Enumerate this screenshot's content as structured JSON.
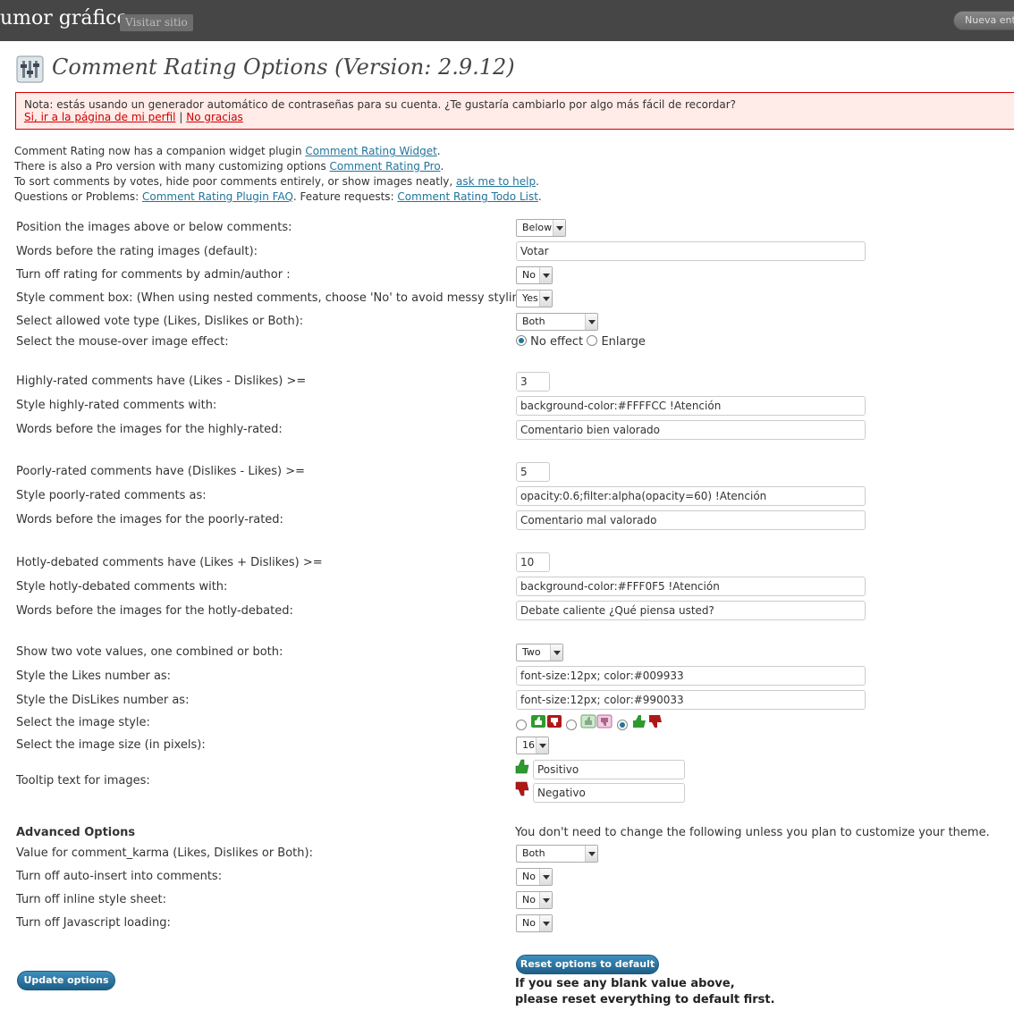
{
  "header": {
    "site_title": "umor gráfico",
    "visit_site": "Visitar sitio",
    "new_button": "Nueva ent"
  },
  "page": {
    "title": "Comment Rating Options (Version: 2.9.12)"
  },
  "notice": {
    "text": "Nota: estás usando un generador automático de contraseñas para su cuenta. ¿Te gustaría cambiarlo por algo más fácil de recordar?",
    "link_profile": "Si, ir a la página de mi perfil",
    "separator": "|",
    "link_no": "No gracias"
  },
  "intro": {
    "line1_pre": "Comment Rating now has a companion widget plugin ",
    "line1_link": "Comment Rating Widget",
    "line1_post": ".",
    "line2_pre": "There is also a Pro version with many customizing options ",
    "line2_link": "Comment Rating Pro",
    "line2_post": ".",
    "line3_pre": "To sort comments by votes, hide poor comments entirely, or show images neatly, ",
    "line3_link": "ask me to help",
    "line3_post": ".",
    "line4_pre": "Questions or Problems: ",
    "line4_link1": "Comment Rating Plugin FAQ",
    "line4_mid": ". Feature requests: ",
    "line4_link2": "Comment Rating Todo List",
    "line4_post": "."
  },
  "options": {
    "position_label": "Position the images above or below comments:",
    "position_value": "Below",
    "words_before_label": "Words before the rating images (default):",
    "words_before_value": "Votar",
    "admin_label": "Turn off rating for comments by admin/author :",
    "admin_value": "No",
    "style_box_label": "Style comment box: (When using nested comments, choose 'No' to avoid messy styling.)",
    "style_box_value": "Yes",
    "vote_type_label": "Select allowed vote type (Likes, Dislikes or Both):",
    "vote_type_value": "Both",
    "mouseover_label": "Select the mouse-over image effect:",
    "mouseover_opt1": "No effect",
    "mouseover_opt2": "Enlarge",
    "high_label": "Highly-rated comments have (Likes - Dislikes) >=",
    "high_value": "3",
    "high_style_label": "Style highly-rated comments with:",
    "high_style_value": "background-color:#FFFFCC !Atención",
    "high_words_label": "Words before the images for the highly-rated:",
    "high_words_value": "Comentario bien valorado",
    "poor_label": "Poorly-rated comments have (Dislikes - Likes) >=",
    "poor_value": "5",
    "poor_style_label": "Style poorly-rated comments as:",
    "poor_style_value": "opacity:0.6;filter:alpha(opacity=60) !Atención",
    "poor_words_label": "Words before the images for the poorly-rated:",
    "poor_words_value": "Comentario mal valorado",
    "hot_label": "Hotly-debated comments have (Likes + Dislikes) >=",
    "hot_value": "10",
    "hot_style_label": "Style hotly-debated comments with:",
    "hot_style_value": "background-color:#FFF0F5 !Atención",
    "hot_words_label": "Words before the images for the hotly-debated:",
    "hot_words_value": "Debate caliente ¿Qué piensa usted?",
    "two_values_label": "Show two vote values, one combined or both:",
    "two_values_value": "Two",
    "likes_style_label": "Style the Likes number as:",
    "likes_style_value": "font-size:12px; color:#009933",
    "dislikes_style_label": "Style the DisLikes number as:",
    "dislikes_style_value": "font-size:12px; color:#990033",
    "image_style_label": "Select the image style:",
    "image_size_label": "Select the image size (in pixels):",
    "image_size_value": "16",
    "tooltip_label": "Tooltip text for images:",
    "tooltip_positive": "Positivo",
    "tooltip_negative": "Negativo"
  },
  "advanced": {
    "heading": "Advanced Options",
    "note": "You don't need to change the following unless you plan to customize your theme.",
    "karma_label": "Value for comment_karma (Likes, Dislikes or Both):",
    "karma_value": "Both",
    "autoinsert_label": "Turn off auto-insert into comments:",
    "autoinsert_value": "No",
    "inline_label": "Turn off inline style sheet:",
    "inline_value": "No",
    "js_label": "Turn off Javascript loading:",
    "js_value": "No"
  },
  "actions": {
    "update": "Update options",
    "reset": "Reset options to default",
    "reset_note_1": "If you see any blank value above,",
    "reset_note_2": "please reset everything to default first."
  },
  "colors": {
    "header_bg": "#464646",
    "link": "#21759b",
    "notice_border": "#cc0000",
    "thumb_up": "#2e9a2e",
    "thumb_down": "#b01818"
  }
}
